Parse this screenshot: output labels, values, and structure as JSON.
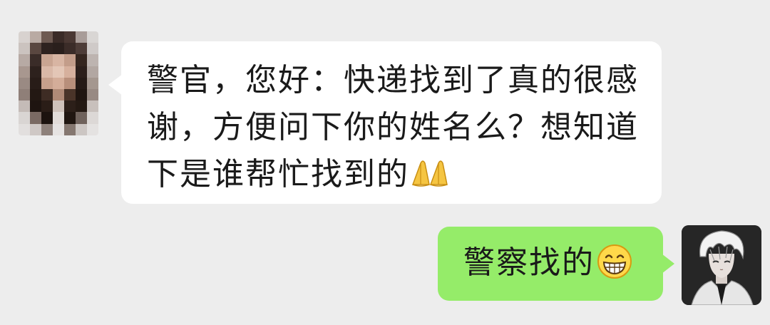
{
  "conversation": {
    "incoming": {
      "sender_avatar_icon": "pixelated-avatar-icon",
      "text": "警官，您好：快递找到了真的很感\n谢，方便问下你的姓名么？想知道\n下是谁帮忙找到的",
      "emoji": "praying-hands-icon"
    },
    "outgoing": {
      "text": "警察找的",
      "emoji": "grinning-face-icon",
      "sender_avatar_icon": "anime-boy-avatar-icon"
    }
  },
  "colors": {
    "background": "#ededed",
    "incoming_bubble": "#ffffff",
    "outgoing_bubble": "#95ec69",
    "text": "#1a1a1a"
  }
}
